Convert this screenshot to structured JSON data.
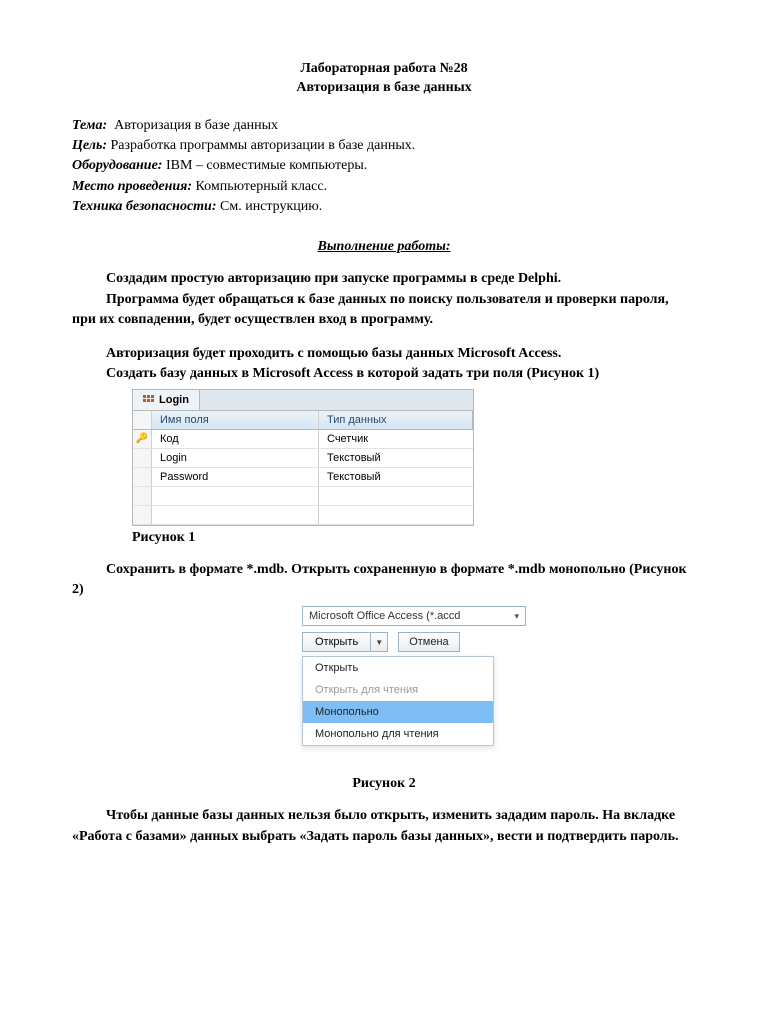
{
  "header": {
    "title1": "Лабораторная работа №28",
    "title2": "Авторизация в базе данных"
  },
  "meta": {
    "theme_label": "Тема:",
    "theme_value": "Авторизация в базе данных",
    "goal_label": "Цель:",
    "goal_value": "Разработка программы авторизации в базе данных.",
    "equip_label": "Оборудование:",
    "equip_value": "IBM – совместимые компьютеры.",
    "place_label": "Место проведения:",
    "place_value": "Компьютерный класс.",
    "safety_label": "Техника безопасности:",
    "safety_value": "См. инструкцию."
  },
  "section_heading": "Выполнение работы:",
  "body": {
    "p1": "Создадим простую авторизацию при запуске программы в среде Delphi.",
    "p2": "Программа будет обращаться к базе данных по поиску пользователя и проверки пароля, при их совпадении, будет осуществлен вход в программу.",
    "p3": "Авторизация будет проходить с помощью базы  данных Microsoft Access.",
    "p4": "Создать базу данных  в Microsoft Access в которой задать три поля (Рисунок 1)",
    "fig1_caption": "Рисунок 1",
    "p5": "Сохранить в формате *.mdb. Открыть сохраненную в формате *.mdb монопольно (Рисунок 2)",
    "fig2_caption": "Рисунок 2",
    "p6": "Чтобы данные базы данных  нельзя было открыть, изменить зададим пароль.  На вкладке «Работа с базами» данных выбрать «Задать пароль базы данных», вести  и подтвердить пароль."
  },
  "access_table": {
    "tab_label": "Login",
    "header_field": "Имя поля",
    "header_type": "Тип данных",
    "rows": [
      {
        "key": true,
        "name": "Код",
        "type": "Счетчик"
      },
      {
        "key": false,
        "name": "Login",
        "type": "Текстовый"
      },
      {
        "key": false,
        "name": "Password",
        "type": "Текстовый"
      }
    ]
  },
  "open_dialog": {
    "filetype_label": "Microsoft Office Access (*.accd",
    "open_btn": "Открыть",
    "cancel_btn": "Отмена",
    "menu": {
      "open": "Открыть",
      "open_readonly": "Открыть для чтения",
      "exclusive": "Монопольно",
      "exclusive_readonly": "Монопольно для чтения"
    }
  }
}
